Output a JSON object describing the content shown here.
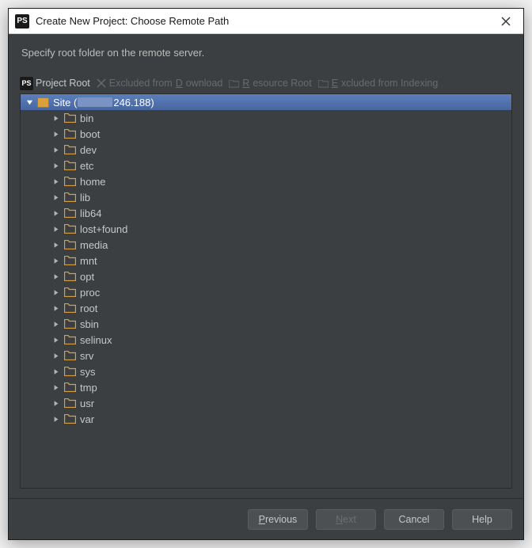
{
  "window": {
    "app_badge": "PS",
    "title": "Create New Project: Choose Remote Path"
  },
  "instruction": "Specify root folder on the remote server.",
  "toolbar": {
    "ps_badge": "PS",
    "project_root": "Project Root",
    "excluded_download_pre": "Excluded from ",
    "excluded_download_u": "D",
    "excluded_download_post": "ownload",
    "resource_root_u": "R",
    "resource_root_post": "esource Root",
    "excluded_indexing_u": "E",
    "excluded_indexing_post": "xcluded from Indexing"
  },
  "tree": {
    "root_label_pre": "Site (",
    "root_label_post": "246.188)",
    "children": [
      "bin",
      "boot",
      "dev",
      "etc",
      "home",
      "lib",
      "lib64",
      "lost+found",
      "media",
      "mnt",
      "opt",
      "proc",
      "root",
      "sbin",
      "selinux",
      "srv",
      "sys",
      "tmp",
      "usr",
      "var"
    ]
  },
  "buttons": {
    "previous_u": "P",
    "previous_post": "revious",
    "next_u": "N",
    "next_post": "ext",
    "cancel": "Cancel",
    "help": "Help"
  }
}
